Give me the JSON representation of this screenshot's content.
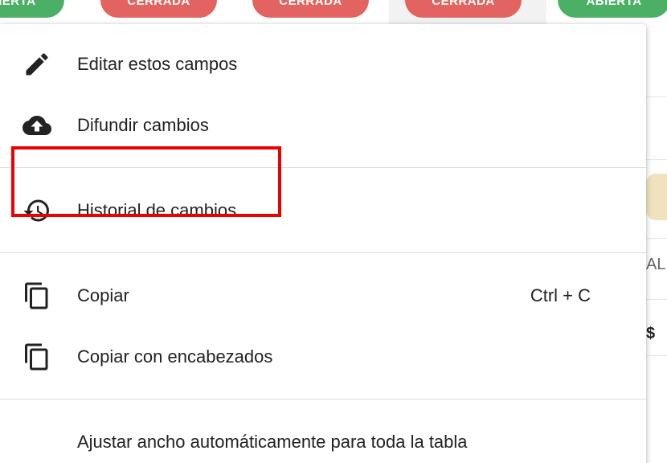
{
  "background": {
    "status_pills": [
      {
        "label": "ABIERTA",
        "color": "#4caf66"
      },
      {
        "label": "CERRADA",
        "color": "#e2635f"
      },
      {
        "label": "CERRADA",
        "color": "#e2635f"
      },
      {
        "label": "CERRADA",
        "color": "#e2635f"
      },
      {
        "label": "ABIERTA",
        "color": "#4caf66"
      }
    ],
    "right_partial_texts": {
      "col_header": "AL",
      "currency": "$"
    }
  },
  "menu": {
    "items": [
      {
        "label": "Editar estos campos",
        "icon": "pencil-icon"
      },
      {
        "label": "Difundir cambios",
        "icon": "cloud-upload-icon"
      },
      {
        "label": "Historial de cambios",
        "icon": "history-icon",
        "highlighted": true
      },
      {
        "label": "Copiar",
        "icon": "copy-icon",
        "shortcut": "Ctrl + C"
      },
      {
        "label": "Copiar con encabezados",
        "icon": "copy-icon"
      },
      {
        "label": "Ajustar ancho automáticamente para toda la tabla"
      }
    ]
  },
  "colors": {
    "highlight_border": "#ee0000",
    "icon": "#222222"
  }
}
